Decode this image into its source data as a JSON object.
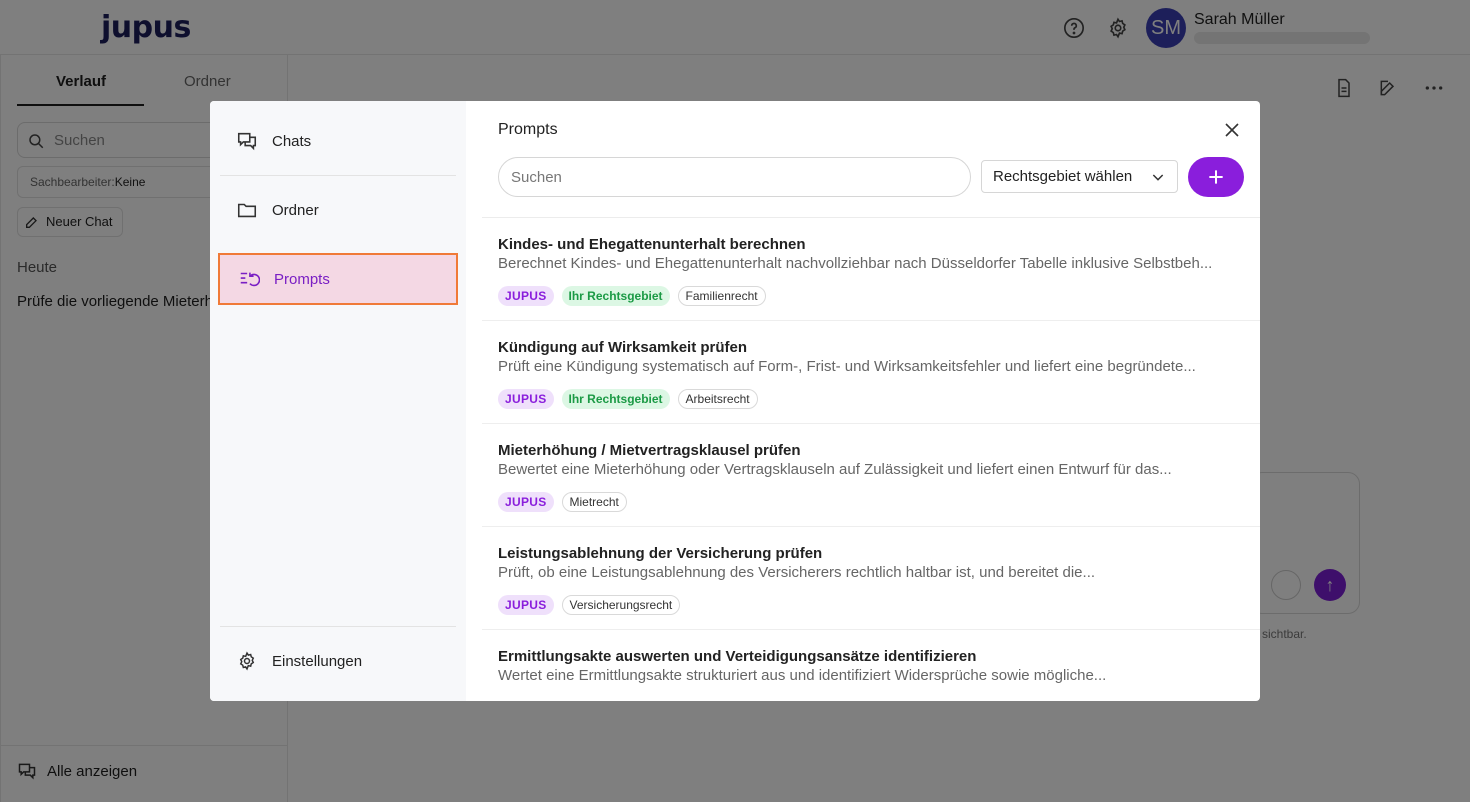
{
  "app": {
    "logo": "jupus"
  },
  "user": {
    "initials": "SM",
    "name": "Sarah Müller"
  },
  "background_sidebar": {
    "tabs": [
      "Verlauf",
      "Ordner"
    ],
    "search_placeholder": "Suchen",
    "filter_label": "Sachbearbeiter:",
    "filter_value": "Keine",
    "new_chat": "Neuer Chat",
    "section_today": "Heute",
    "chat_item": "Prüfe die vorliegende Mieterhöhung",
    "show_all": "Alle anzeigen"
  },
  "background_main": {
    "footnote": "sichtbar."
  },
  "modal": {
    "nav": {
      "chats": "Chats",
      "ordner": "Ordner",
      "prompts": "Prompts",
      "settings": "Einstellungen"
    },
    "title": "Prompts",
    "search_placeholder": "Suchen",
    "area_select": "Rechtsgebiet wählen",
    "prompts": [
      {
        "title": "Kindes- und Ehegattenunterhalt berechnen",
        "description": "Berechnet Kindes- und Ehegattenunterhalt nachvollziehbar nach Düsseldorfer Tabelle inklusive Selbstbeh...",
        "tags": [
          "JUPUS",
          "Ihr Rechtsgebiet",
          "Familienrecht"
        ]
      },
      {
        "title": "Kündigung auf Wirksamkeit prüfen",
        "description": "Prüft eine Kündigung systematisch auf Form-, Frist- und Wirksamkeitsfehler und liefert eine begründete...",
        "tags": [
          "JUPUS",
          "Ihr Rechtsgebiet",
          "Arbeitsrecht"
        ]
      },
      {
        "title": "Mieterhöhung / Mietvertragsklausel prüfen",
        "description": "Bewertet eine Mieterhöhung oder Vertragsklauseln auf Zulässigkeit und liefert einen Entwurf für das...",
        "tags": [
          "JUPUS",
          "Mietrecht"
        ]
      },
      {
        "title": "Leistungsablehnung der Versicherung prüfen",
        "description": "Prüft, ob eine Leistungsablehnung des Versicherers rechtlich haltbar ist, und bereitet die...",
        "tags": [
          "JUPUS",
          "Versicherungsrecht"
        ]
      },
      {
        "title": "Ermittlungsakte auswerten und Verteidigungsansätze identifizieren",
        "description": "Wertet eine Ermittlungsakte strukturiert aus und identifiziert Widersprüche sowie mögliche...",
        "tags": []
      }
    ]
  },
  "colors": {
    "accent": "#8a1edc",
    "active_nav_bg": "#f4d8e4",
    "active_nav_border": "#f07a38",
    "own_area_tag": "#1b9a45"
  },
  "icons": [
    "chats-icon",
    "folder-icon",
    "prompts-icon",
    "gear-icon",
    "close-icon",
    "chevron-down-icon",
    "plus-icon",
    "help-icon"
  ]
}
